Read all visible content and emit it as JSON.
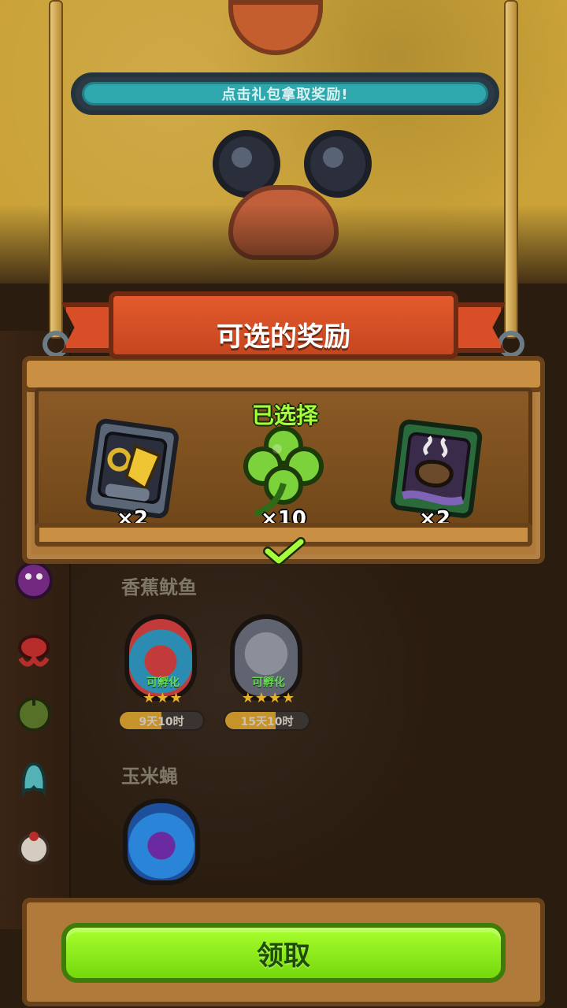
{
  "banner": {
    "text": "点击礼包拿取奖励!"
  },
  "modal": {
    "title": "可选的奖励",
    "selected_label": "已选择",
    "rewards": [
      {
        "icon": "robot-card-icon",
        "qty": "×2"
      },
      {
        "icon": "four-leaf-clover-icon",
        "qty": "×10",
        "selected": true
      },
      {
        "icon": "cauldron-card-icon",
        "qty": "×2"
      }
    ]
  },
  "background_list": {
    "section1": {
      "title": "香蕉鱿鱼",
      "eggs": [
        {
          "status": "可孵化",
          "stars": "★★★",
          "time": "9天10时",
          "progress": 0.5
        },
        {
          "status": "可孵化",
          "stars": "★★★★",
          "time": "15天10时",
          "progress": 0.6
        }
      ]
    },
    "section2": {
      "title": "玉米蝇"
    }
  },
  "buttons": {
    "claim": "领取"
  },
  "colors": {
    "accent_green": "#a6ff3b",
    "button_green": "#74d80b",
    "ribbon_orange": "#d84f27",
    "wood": "#b07a3a"
  }
}
